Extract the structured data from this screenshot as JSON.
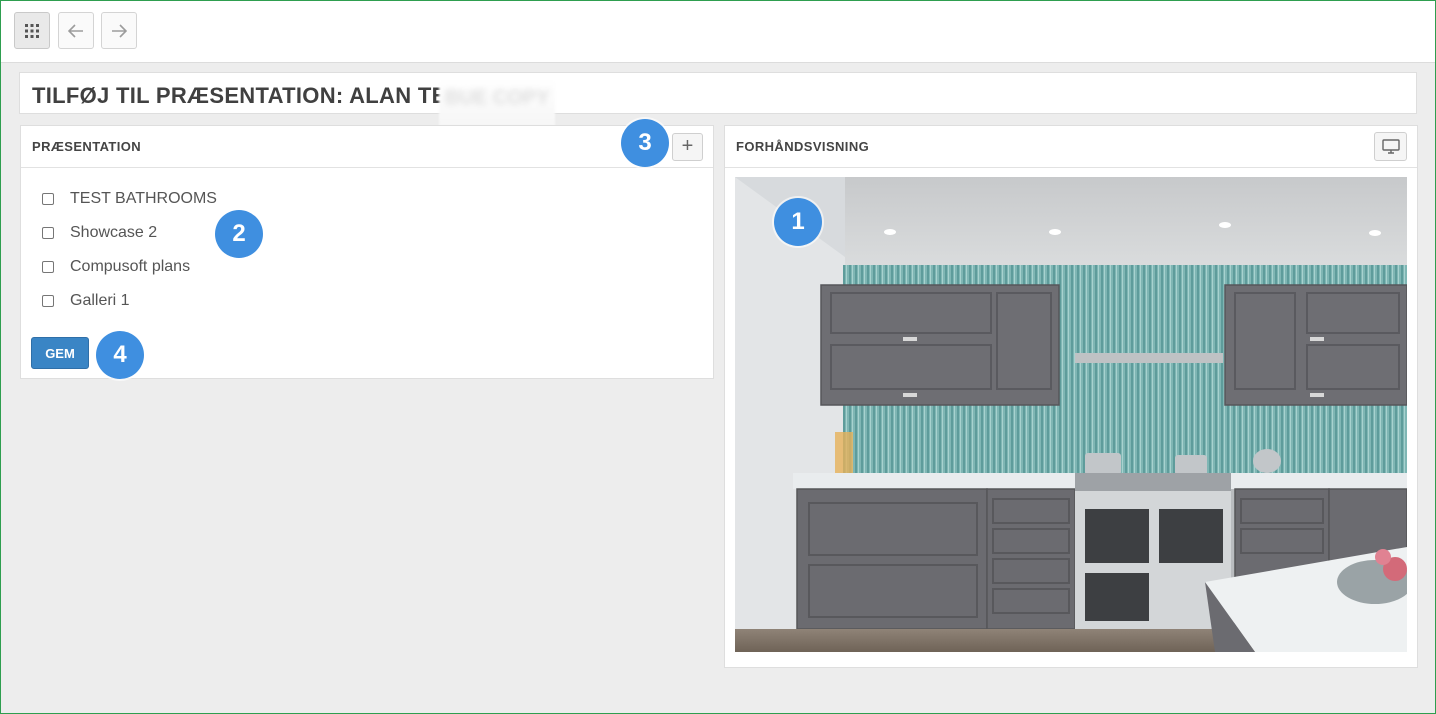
{
  "topbar": {
    "icons": [
      "apps-grid-icon",
      "arrow-left-icon",
      "arrow-right-icon"
    ]
  },
  "title": {
    "text": "TILFØJ TIL PRÆSENTATION: ALAN TESTV",
    "blurred_suffix": "BUE COPY"
  },
  "presentation_panel": {
    "header": "PRÆSENTATION",
    "add_button": "+",
    "items": [
      {
        "label": "TEST BATHROOMS",
        "checked": false
      },
      {
        "label": "Showcase 2",
        "checked": false
      },
      {
        "label": "Compusoft plans",
        "checked": false
      },
      {
        "label": "Galleri 1",
        "checked": false
      }
    ],
    "save_label": "GEM"
  },
  "preview_panel": {
    "header": "FORHÅNDSVISNING",
    "icon": "monitor-icon"
  },
  "badges": [
    "1",
    "2",
    "3",
    "4"
  ],
  "colors": {
    "accent": "#3a85c5",
    "badge": "#3f8fe0",
    "frame": "#2e9e4f"
  }
}
